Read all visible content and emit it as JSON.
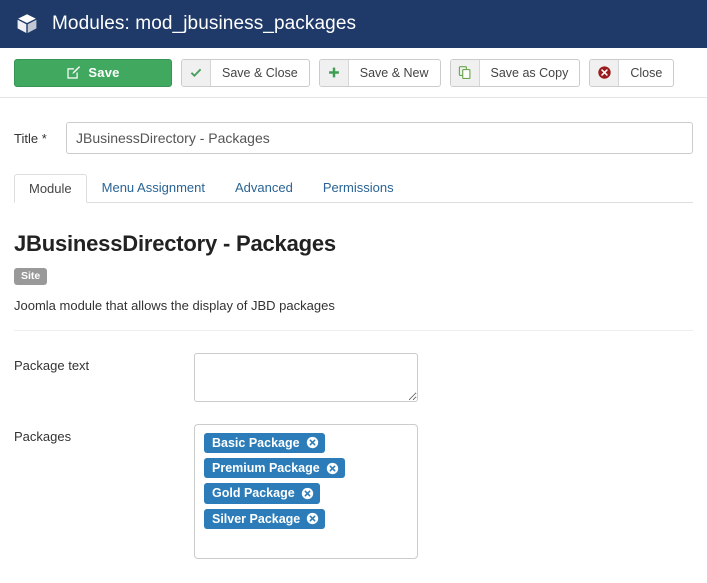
{
  "header": {
    "icon": "cube-icon",
    "title": "Modules: mod_jbusiness_packages",
    "background_color": "#1f3a68"
  },
  "toolbar": {
    "buttons": [
      {
        "label": "Save",
        "icon": "pencil-square-icon",
        "style": "primary-green",
        "color": "#41a85f"
      },
      {
        "label": "Save & Close",
        "icon": "check-icon",
        "style": "default"
      },
      {
        "label": "Save & New",
        "icon": "plus-icon",
        "style": "default"
      },
      {
        "label": "Save as Copy",
        "icon": "copy-icon",
        "style": "default"
      },
      {
        "label": "Close",
        "icon": "circle-x-icon",
        "style": "default"
      }
    ]
  },
  "form": {
    "title_field": {
      "label": "Title",
      "required_marker": "*",
      "value": "JBusinessDirectory - Packages",
      "placeholder": ""
    }
  },
  "tabs": [
    {
      "label": "Module",
      "active": true
    },
    {
      "label": "Menu Assignment",
      "active": false
    },
    {
      "label": "Advanced",
      "active": false
    },
    {
      "label": "Permissions",
      "active": false
    }
  ],
  "module_info": {
    "heading": "JBusinessDirectory - Packages",
    "badge": "Site",
    "badge_color": "#999999",
    "description": "Joomla module that allows the display of JBD packages"
  },
  "fields": {
    "package_text": {
      "label": "Package text",
      "value": "",
      "placeholder": ""
    },
    "packages": {
      "label": "Packages",
      "tag_color": "#2b7cb8",
      "tags": [
        {
          "label": "Basic Package",
          "remove_icon": "circle-x-icon"
        },
        {
          "label": "Premium Package",
          "remove_icon": "circle-x-icon"
        },
        {
          "label": "Gold Package",
          "remove_icon": "circle-x-icon"
        },
        {
          "label": "Silver Package",
          "remove_icon": "circle-x-icon"
        }
      ]
    }
  }
}
